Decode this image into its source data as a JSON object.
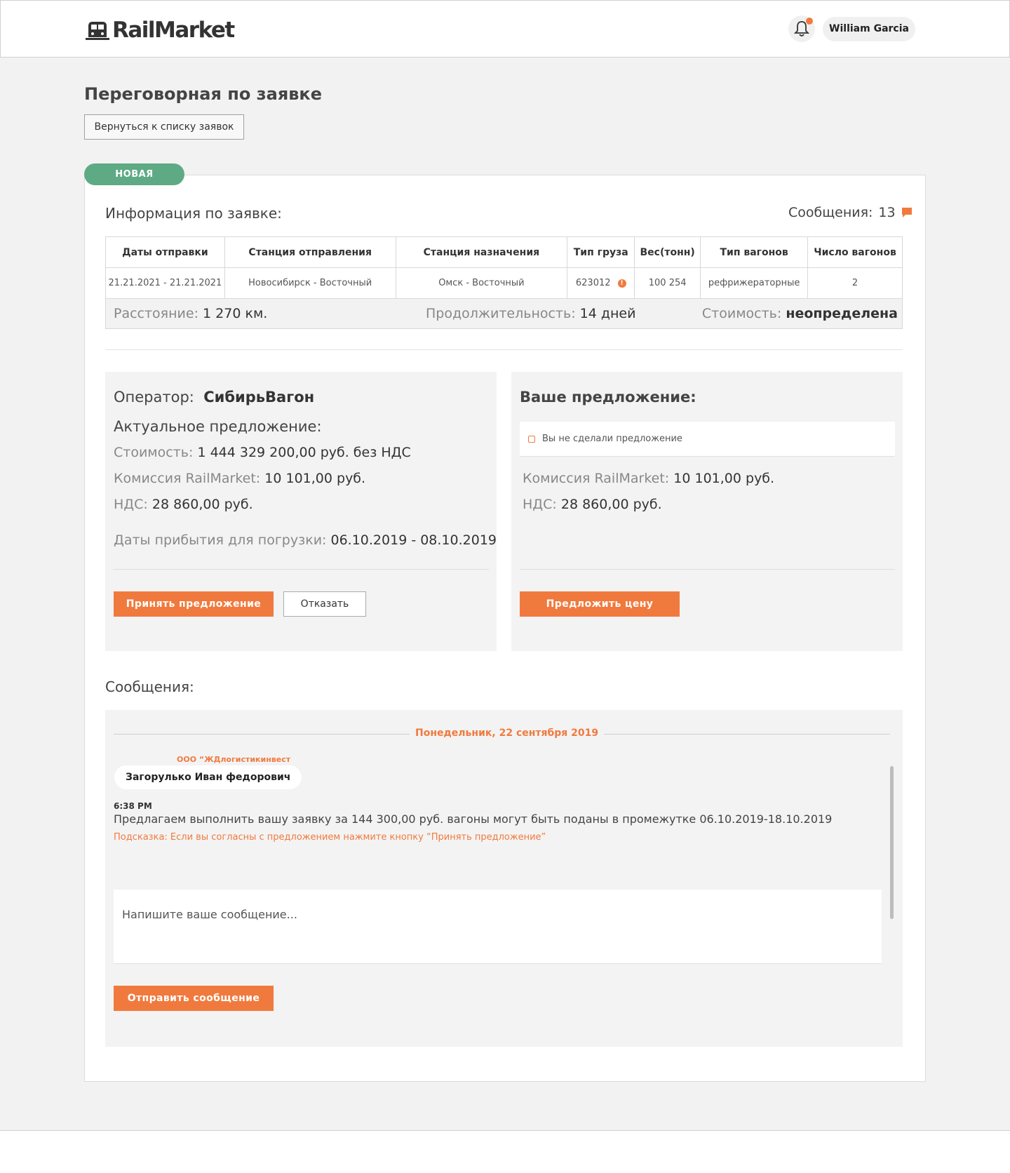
{
  "header": {
    "logo_text": "RailMarket",
    "user_name": "William Garcia"
  },
  "page": {
    "title": "Переговорная по заявке",
    "back_label": "Вернуться к списку заявок",
    "status": "НОВАЯ"
  },
  "info": {
    "title": "Информация по заявке:",
    "messages_label": "Сообщения:",
    "messages_count": "13",
    "columns": [
      "Даты отправки",
      "Станция отправления",
      "Станция назначения",
      "Тип груза",
      "Вес(тонн)",
      "Тип вагонов",
      "Число вагонов"
    ],
    "row": [
      "21.21.2021 - 21.21.2021",
      "Новосибирск - Восточный",
      "Омск - Восточный",
      "623012",
      "100 254",
      "рефрижераторные",
      "2"
    ],
    "distance_label": "Расстояние:",
    "distance_value": "1 270 км.",
    "duration_label": "Продолжительность:",
    "duration_value": "14 дней",
    "cost_label": "Стоимость:",
    "cost_value": "неопределена"
  },
  "operator_panel": {
    "operator_label": "Оператор:",
    "operator_name": "СибирьВагон",
    "actual_title": "Актуальное предложение:",
    "cost_label": "Стоимость:",
    "cost_value": "1 444 329 200,00 руб. без НДС",
    "commission_label": "Комиссия RailMarket:",
    "commission_value": "10 101,00 руб.",
    "vat_label": "НДС:",
    "vat_value": "28 860,00 руб.",
    "dates_label": "Даты прибытия для погрузки:",
    "dates_value": "06.10.2019 - 08.10.2019",
    "accept_label": "Принять предложение",
    "decline_label": "Отказать"
  },
  "your_panel": {
    "title": "Ваше предложение:",
    "notice": "Вы не сделали предложение",
    "commission_label": "Комиссия RailMarket:",
    "commission_value": "10 101,00 руб.",
    "vat_label": "НДС:",
    "vat_value": "28 860,00 руб.",
    "propose_label": "Предложить цену"
  },
  "messages": {
    "title": "Сообщения:",
    "date": "Понедельник, 22 сентября 2019",
    "company": "ООО “ЖДлогистикинвест",
    "author": "Загорулько Иван федорович",
    "time": "6:38 PM",
    "text": "Предлагаем выполнить вашу заявку за 144 300,00 руб. вагоны могут быть поданы в промежутке 06.10.2019-18.10.2019",
    "hint": "Подсказка: Если вы согласны с предложением нажмите кнопку “Принять предложение”",
    "placeholder": "Напишите ваше сообщение...",
    "send_label": "Отправить сообщение"
  },
  "colors": {
    "accent": "#f07a3e",
    "status": "#5eaa84"
  }
}
